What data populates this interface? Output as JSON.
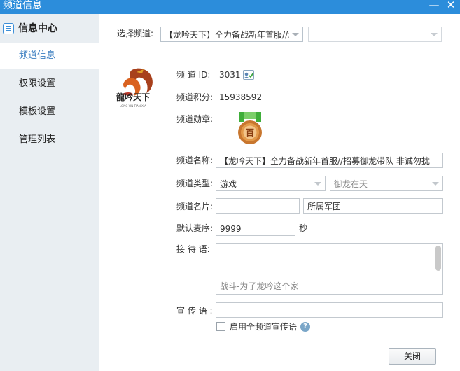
{
  "window": {
    "title": "频道信息"
  },
  "sidebar": {
    "header": "信息中心",
    "items": [
      {
        "label": "频道信息",
        "active": true
      },
      {
        "label": "权限设置",
        "active": false
      },
      {
        "label": "模板设置",
        "active": false
      },
      {
        "label": "管理列表",
        "active": false
      }
    ]
  },
  "channel_select": {
    "label": "选择频道:",
    "value": "【龙吟天下】全力备战新年首服//:",
    "secondary_value": ""
  },
  "info": {
    "id_label": "频 道 ID:",
    "id_value": "3031",
    "score_label": "频道积分:",
    "score_value": "15938592",
    "medal_label": "频道勋章:",
    "medal_text": "百"
  },
  "form": {
    "name_label": "频道名称:",
    "name_value": "【龙吟天下】全力备战新年首服//招募御龙带队 非诚勿扰",
    "type_label": "频道类型:",
    "type_value": "游戏",
    "subtype_value": "御龙在天",
    "card_label": "频道名片:",
    "card_value": "",
    "legion_value": "所属军团",
    "mic_label": "默认麦序:",
    "mic_value": "9999",
    "mic_unit": "秒",
    "greeting_label": "接 待 语:",
    "greeting_placeholder": "战斗-为了龙吟这个家",
    "promo_label": "宣 传 语 :",
    "promo_value": "",
    "enable_promo_label": "启用全频道宣传语",
    "help_glyph": "?"
  },
  "buttons": {
    "close": "关闭"
  },
  "colors": {
    "titlebar": "#2c8ddb",
    "sidebar": "#e9eef2",
    "active_text": "#3d7fc1",
    "medal_green": "#3fae3a",
    "medal_bronze": "#c8762e"
  }
}
